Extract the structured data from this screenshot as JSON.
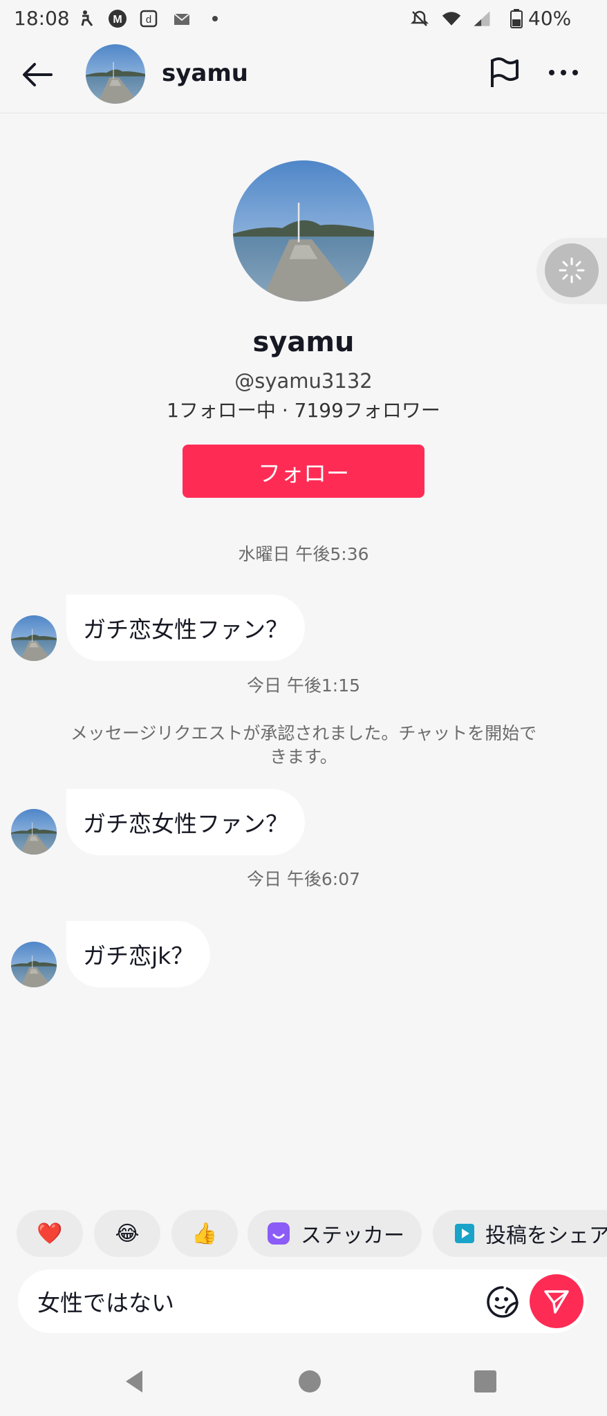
{
  "status_bar": {
    "time": "18:08",
    "battery": "40%",
    "icons": [
      "accessibility-icon",
      "m-app-icon",
      "d-app-icon",
      "mail-icon",
      "dot-icon",
      "mute-icon",
      "wifi-icon",
      "signal-icon",
      "battery-icon"
    ]
  },
  "header": {
    "name": "syamu",
    "back_icon": "back-arrow-icon",
    "report_icon": "flag-icon",
    "more_icon": "more-icon"
  },
  "profile": {
    "name": "syamu",
    "handle": "@syamu3132",
    "stats": "1フォロー中 · 7199フォロワー",
    "follow_label": "フォロー"
  },
  "messages": [
    {
      "type": "timestamp",
      "text": "水曜日 午後5:36"
    },
    {
      "type": "incoming",
      "text": "ガチ恋女性ファン？"
    },
    {
      "type": "timestamp",
      "text": "今日 午後1:15"
    },
    {
      "type": "system",
      "text": "メッセージリクエストが承認されました。チャットを開始できます。"
    },
    {
      "type": "incoming",
      "text": "ガチ恋女性ファン？"
    },
    {
      "type": "timestamp",
      "text": "今日 午後6:07"
    },
    {
      "type": "incoming",
      "text": "ガチ恋jk？"
    }
  ],
  "quick_replies": {
    "heart": "❤️",
    "laugh": "😂",
    "thumbs": "👍",
    "sticker_label": "ステッカー",
    "share_label": "投稿をシェア"
  },
  "composer": {
    "input_value": "女性ではない",
    "emoji_icon": "sticker-face-icon",
    "send_icon": "send-icon"
  },
  "colors": {
    "accent": "#fe2c55",
    "background": "#f6f6f6",
    "bubble": "#ffffff"
  }
}
